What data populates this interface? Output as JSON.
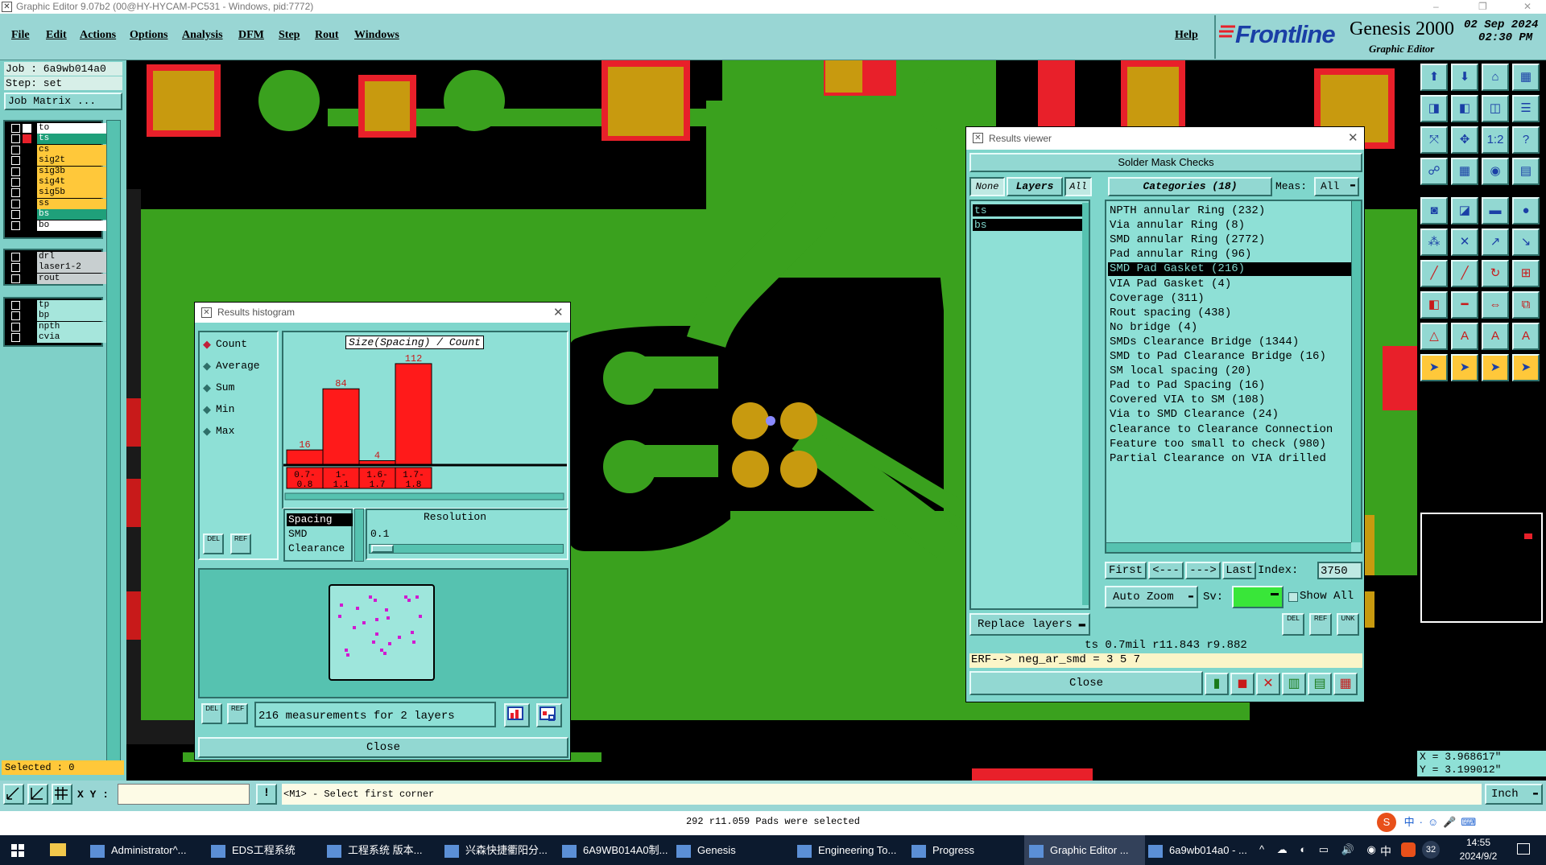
{
  "window": {
    "title": "Graphic Editor 9.07b2 (00@HY-HYCAM-PC531 - Windows, pid:7772)"
  },
  "menu": {
    "items": [
      "File",
      "Edit",
      "Actions",
      "Options",
      "Analysis",
      "DFM",
      "Step",
      "Rout",
      "Windows"
    ],
    "help": "Help"
  },
  "brand": {
    "logo": "Frontline",
    "product": "Genesis 2000",
    "subtitle": "Graphic Editor",
    "date": "02 Sep 2024",
    "time": "02:30 PM",
    "accent": "#e8202a"
  },
  "left": {
    "job": "Job : 6a9wb014a0",
    "step": "Step: set",
    "job_matrix": "Job Matrix ...",
    "layers_group1": [
      {
        "name": "to",
        "color": "#ffffff",
        "fill": "#ffffff"
      },
      {
        "name": "ts",
        "color": "#e8202a",
        "fill": "#1fa07a"
      },
      {
        "name": "cs",
        "color": "#000000",
        "fill": "#ffc83a"
      },
      {
        "name": "sig2t",
        "color": "#000000",
        "fill": "#ffc83a"
      },
      {
        "name": "sig3b",
        "color": "#000000",
        "fill": "#ffc83a"
      },
      {
        "name": "sig4t",
        "color": "#000000",
        "fill": "#ffc83a"
      },
      {
        "name": "sig5b",
        "color": "#000000",
        "fill": "#ffc83a"
      },
      {
        "name": "ss",
        "color": "#000000",
        "fill": "#ffc83a"
      },
      {
        "name": "bs",
        "color": "#000000",
        "fill": "#1fa07a"
      },
      {
        "name": "bo",
        "color": "#000000",
        "fill": "#ffffff"
      }
    ],
    "layers_group2": [
      "drl",
      "laser1-2",
      "rout"
    ],
    "layers_group3": [
      "tp",
      "bp",
      "npth",
      "cvia"
    ],
    "selected": "Selected : 0"
  },
  "histogram": {
    "title": "Results histogram",
    "radio": [
      "Count",
      "Average",
      "Sum",
      "Min",
      "Max"
    ],
    "chart_title": "Size(Spacing) / Count",
    "bins": [
      "0.7-\n0.8",
      "1-\n1.1",
      "1.6-\n1.7",
      "1.7-\n1.8"
    ],
    "spacing_list": [
      "Spacing",
      "SMD",
      "Clearance"
    ],
    "resolution_label": "Resolution",
    "resolution_value": "0.1",
    "measurements": "216 measurements for 2 layers",
    "close": "Close",
    "del": "DEL",
    "ref": "REF"
  },
  "chart_data": {
    "type": "bar",
    "title": "Size(Spacing) / Count",
    "categories": [
      "0.7-0.8",
      "1-1.1",
      "1.6-1.7",
      "1.7-1.8"
    ],
    "values": [
      16,
      84,
      4,
      112
    ],
    "ylim": [
      0,
      120
    ],
    "bar_color": "#ff1a1a"
  },
  "viewer": {
    "title": "Results viewer",
    "header": "Solder Mask Checks",
    "none": "None",
    "layers": "Layers",
    "all": "All",
    "categories_label": "Categories (18)",
    "meas_label": "Meas:",
    "meas_value": "All",
    "layer_list": [
      "ts",
      "bs"
    ],
    "categories": [
      "NPTH annular Ring (232)",
      "Via annular Ring (8)",
      "SMD annular Ring (2772)",
      "Pad annular Ring (96)",
      "SMD Pad Gasket (216)",
      "VIA Pad Gasket (4)",
      "Coverage (311)",
      "Rout spacing (438)",
      "No bridge (4)",
      "SMDs Clearance Bridge (1344)",
      "SMD to Pad Clearance Bridge (16)",
      "SM local spacing (20)",
      "Pad to Pad Spacing (16)",
      "Covered VIA to SM (108)",
      "Via to SMD Clearance (24)",
      "Clearance to Clearance Connection",
      "Feature too small to check (980)",
      "Partial Clearance on VIA drilled"
    ],
    "selected_index": 4,
    "first": "First",
    "prev": "<---",
    "next": "--->",
    "last": "Last",
    "index_label": "Index:",
    "index_value": "3750",
    "auto_zoom": "Auto Zoom",
    "sv_label": "Sv:",
    "show_all": "Show All",
    "replace_layers": "Replace layers",
    "info_line": "ts 0.7mil   r11.843   r9.882",
    "erf_line": "ERF--> neg_ar_smd = 3 5 7",
    "close": "Close",
    "del": "DEL",
    "ref": "REF",
    "unk": "UNK"
  },
  "coords": {
    "x": "X = 3.968617\"",
    "y": "Y = 3.199012\""
  },
  "bottom": {
    "xy_label": "X Y :",
    "prompt": "<M1> - Select first corner",
    "units": "Inch",
    "status": "292 r11.059 Pads were selected"
  },
  "taskbar": {
    "items": [
      {
        "label": "Administrator^...",
        "active": false
      },
      {
        "label": "EDS工程系统",
        "active": false
      },
      {
        "label": "工程系统  版本...",
        "active": false
      },
      {
        "label": "兴森快捷衢阳分...",
        "active": false
      },
      {
        "label": "6A9WB014A0制...",
        "active": false
      },
      {
        "label": "Genesis",
        "active": false
      },
      {
        "label": "Engineering To...",
        "active": false
      },
      {
        "label": "Progress",
        "active": false
      },
      {
        "label": "Graphic Editor ...",
        "active": true
      },
      {
        "label": "6a9wb014a0 - ...",
        "active": false
      }
    ],
    "time": "14:55",
    "date": "2024/9/2",
    "ime": "中",
    "badge": "32"
  }
}
